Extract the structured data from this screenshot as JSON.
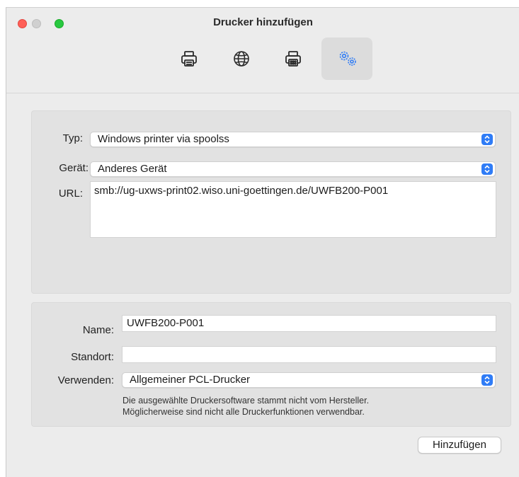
{
  "window": {
    "title": "Drucker hinzufügen"
  },
  "toolbar": {
    "items": [
      {
        "icon": "printer-icon",
        "selected": false
      },
      {
        "icon": "globe-icon",
        "selected": false
      },
      {
        "icon": "printer-fax-icon",
        "selected": false
      },
      {
        "icon": "gears-icon",
        "selected": true
      }
    ]
  },
  "connection": {
    "type_label": "Typ:",
    "type_value": "Windows printer via spoolss",
    "device_label": "Gerät:",
    "device_value": "Anderes Gerät",
    "url_label": "URL:",
    "url_value": "smb://ug-uxws-print02.wiso.uni-goettingen.de/UWFB200-P001"
  },
  "printer": {
    "name_label": "Name:",
    "name_value": "UWFB200-P001",
    "location_label": "Standort:",
    "location_value": "",
    "use_label": "Verwenden:",
    "use_value": "Allgemeiner PCL-Drucker",
    "note_line1": "Die ausgewählte Druckersoftware stammt nicht vom Hersteller.",
    "note_line2": "Möglicherweise sind nicht alle Druckerfunktionen verwendbar."
  },
  "actions": {
    "add_label": "Hinzufügen"
  },
  "colors": {
    "accent": "#2f7cf6",
    "close": "#ff5f57",
    "zoom": "#28c840"
  }
}
